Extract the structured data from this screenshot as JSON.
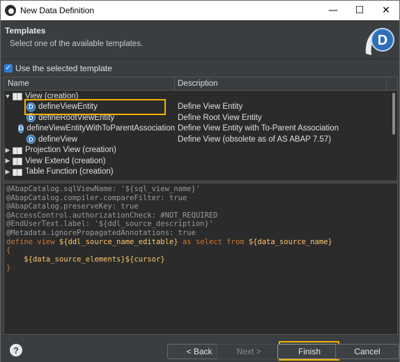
{
  "window": {
    "title": "New Data Definition",
    "minimize": "—",
    "maximize": "☐",
    "close": "✕"
  },
  "header": {
    "title": "Templates",
    "description": "Select one of the available templates.",
    "logo_letter": "D"
  },
  "use_template": {
    "label": "Use the selected template",
    "checked": true
  },
  "table": {
    "columns": [
      "Name",
      "Description"
    ],
    "rows": [
      {
        "name": "View (creation)",
        "description": "",
        "level": 0,
        "expanded": true,
        "icon": "book-icon"
      },
      {
        "name": "defineViewEntity",
        "description": "Define View Entity",
        "level": 1,
        "icon": "ddl-template-icon",
        "selected": true
      },
      {
        "name": "defineRootViewEntity",
        "description": "Define Root View Entity",
        "level": 1,
        "icon": "ddl-template-icon"
      },
      {
        "name": "defineViewEntityWithToParentAssociation",
        "description": "Define View Entity with To-Parent Association",
        "level": 1,
        "icon": "ddl-template-icon"
      },
      {
        "name": "defineView",
        "description": "Define View (obsolete as of AS ABAP 7.57)",
        "level": 1,
        "icon": "ddl-template-icon"
      },
      {
        "name": "Projection View (creation)",
        "description": "",
        "level": 0,
        "expanded": false,
        "icon": "book-icon"
      },
      {
        "name": "View Extend (creation)",
        "description": "",
        "level": 0,
        "expanded": false,
        "icon": "book-icon"
      },
      {
        "name": "Table Function (creation)",
        "description": "",
        "level": 0,
        "expanded": false,
        "icon": "book-icon"
      }
    ]
  },
  "code": {
    "lines": [
      "@AbapCatalog.sqlViewName: '${sql_view_name}'",
      "@AbapCatalog.compiler.compareFilter: true",
      "@AbapCatalog.preserveKey: true",
      "@AccessControl.authorizationCheck: #NOT_REQUIRED",
      "@EndUserText.label: '${ddl_source_description}'",
      "@Metadata.ignorePropagatedAnnotations: true"
    ],
    "define_kw": "define view",
    "define_var1": "${ddl_source_name_editable}",
    "define_mid": "as select from",
    "define_var2": "${data_source_name}",
    "open_brace": "{",
    "elements_var": "${data_source_elements}${cursor}",
    "close_brace": "}"
  },
  "footer": {
    "help": "?",
    "back": "< Back",
    "next": "Next >",
    "finish": "Finish",
    "cancel": "Cancel"
  },
  "colors": {
    "highlight": "#f4b400",
    "keyword": "#cc7832",
    "variable": "#ffc66d",
    "annotation": "#9a9a9a"
  }
}
